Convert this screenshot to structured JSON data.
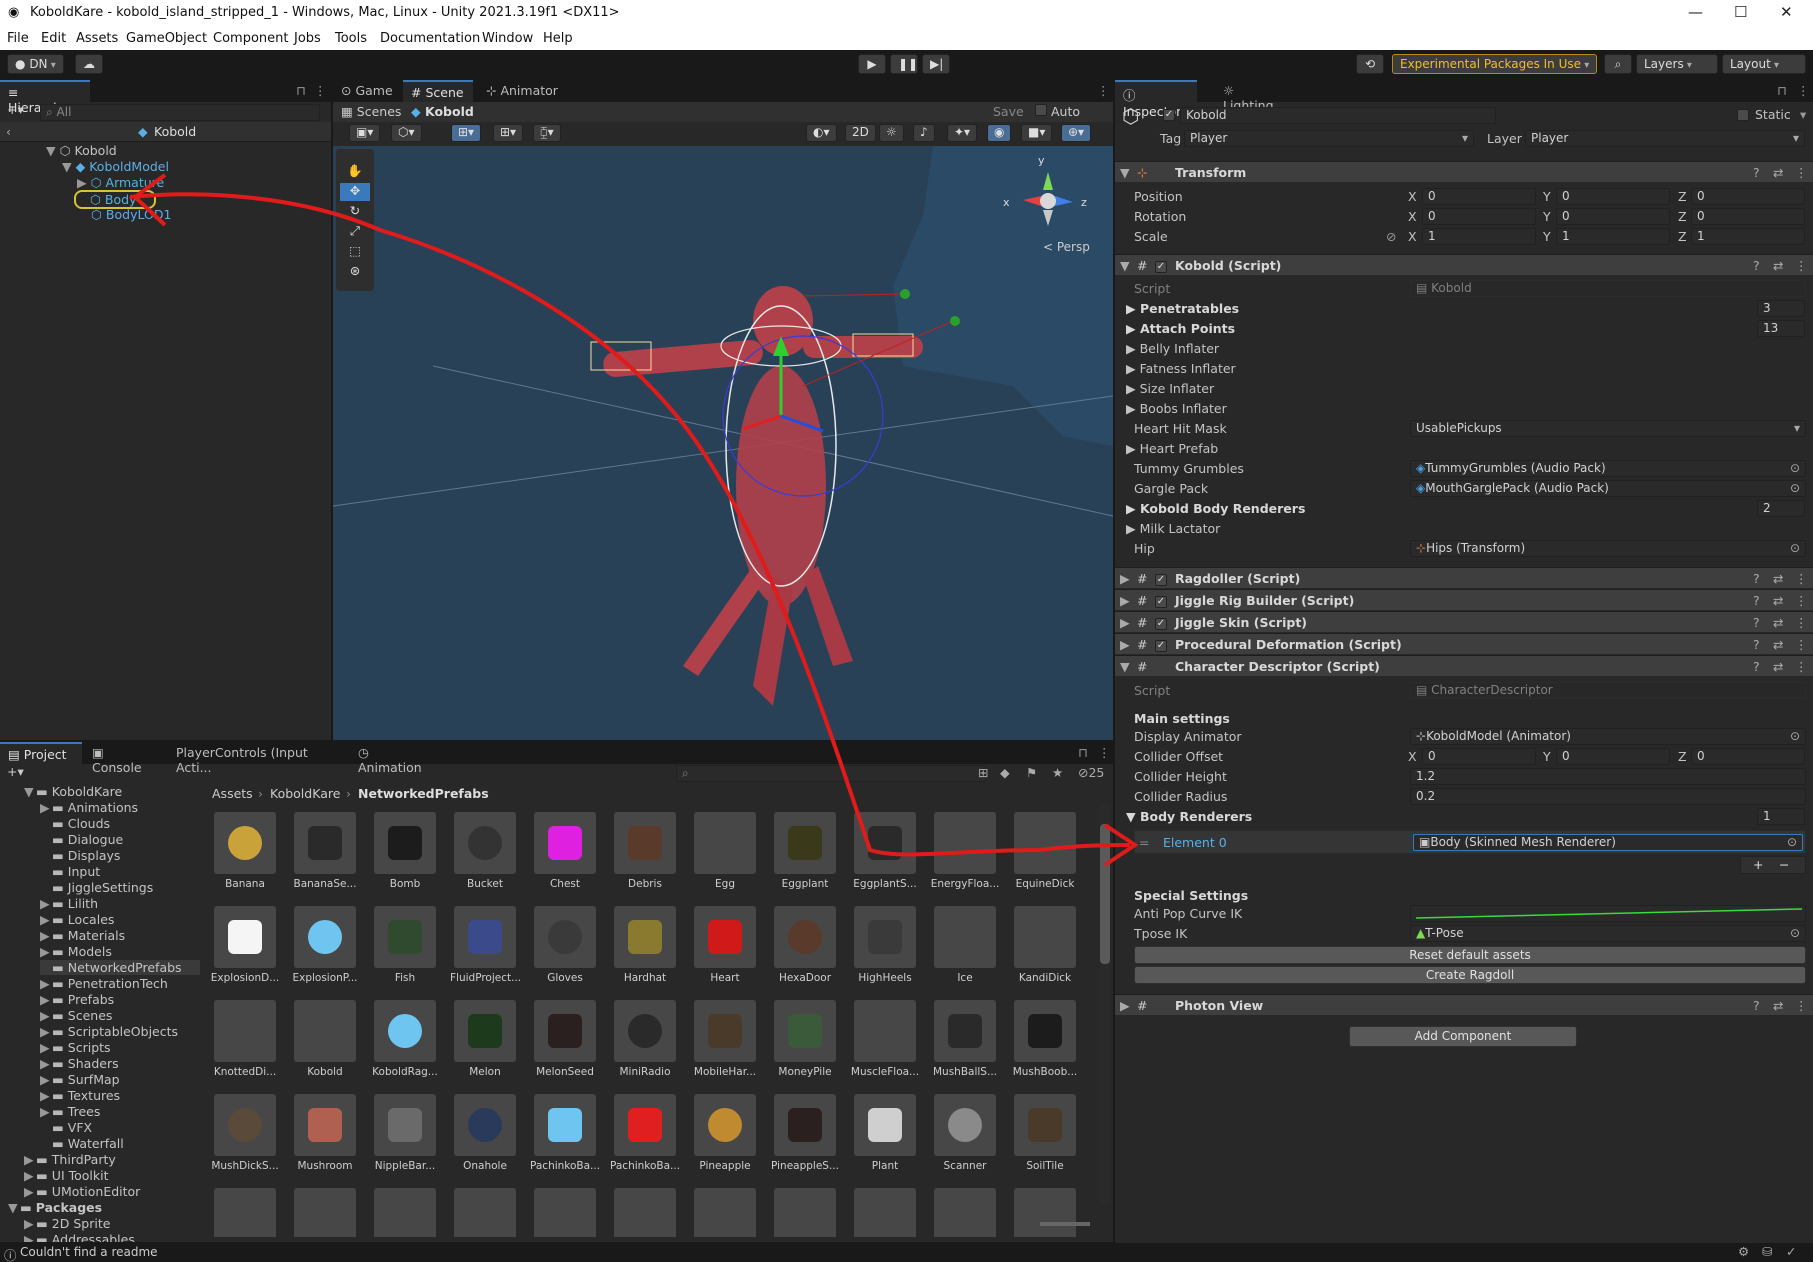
{
  "window": {
    "title": "KoboldKare - kobold_island_stripped_1 - Windows, Mac, Linux - Unity 2021.3.19f1 <DX11>",
    "minimize": "—",
    "maximize": "☐",
    "close": "✕"
  },
  "menu": [
    "File",
    "Edit",
    "Assets",
    "GameObject",
    "Component",
    "Jobs",
    "Tools",
    "Documentation",
    "Window",
    "Help"
  ],
  "toolbar": {
    "account": "DN",
    "experimental": "Experimental Packages In Use",
    "layers": "Layers",
    "layout": "Layout"
  },
  "hierarchy": {
    "tab": "Hierarchy",
    "search_placeholder": "All",
    "scene": "Kobold",
    "items": [
      "Kobold",
      "KoboldModel",
      "Armature",
      "Body",
      "BodyLOD1"
    ]
  },
  "scene_view": {
    "tabs": [
      "Game",
      "Scene",
      "Animator"
    ],
    "breadcrumb_root": "Scenes",
    "breadcrumb_prefab": "Kobold",
    "save": "Save",
    "auto_save": "Auto Save",
    "mode_2d": "2D",
    "persp": "< Persp",
    "gizmo_axes": {
      "x": "x",
      "y": "y",
      "z": "z"
    }
  },
  "inspector": {
    "tabs": [
      "Inspector",
      "Lighting"
    ],
    "object_name": "Kobold",
    "static": "Static",
    "tag_label": "Tag",
    "tag_value": "Player",
    "layer_label": "Layer",
    "layer_value": "Player",
    "transform": {
      "title": "Transform",
      "position": {
        "label": "Position",
        "x": "0",
        "y": "0",
        "z": "0"
      },
      "rotation": {
        "label": "Rotation",
        "x": "0",
        "y": "0",
        "z": "0"
      },
      "scale": {
        "label": "Scale",
        "x": "1",
        "y": "1",
        "z": "1"
      }
    },
    "kobold_script": {
      "title": "Kobold (Script)",
      "script_label": "Script",
      "script_value": "Kobold",
      "penetratables": {
        "label": "Penetratables",
        "value": "3"
      },
      "attach_points": {
        "label": "Attach Points",
        "value": "13"
      },
      "belly": "Belly Inflater",
      "fatness": "Fatness Inflater",
      "size": "Size Inflater",
      "boobs": "Boobs Inflater",
      "heart_hit_mask": {
        "label": "Heart Hit Mask",
        "value": "UsablePickups"
      },
      "heart_prefab": "Heart Prefab",
      "tummy": {
        "label": "Tummy Grumbles",
        "value": "TummyGrumbles (Audio Pack)"
      },
      "gargle": {
        "label": "Gargle Pack",
        "value": "MouthGarglePack (Audio Pack)"
      },
      "body_renderers": {
        "label": "Kobold Body Renderers",
        "value": "2"
      },
      "milk": "Milk Lactator",
      "hip": {
        "label": "Hip",
        "value": "Hips (Transform)"
      }
    },
    "components": [
      "Ragdoller (Script)",
      "Jiggle Rig Builder (Script)",
      "Jiggle Skin (Script)",
      "Procedural Deformation (Script)"
    ],
    "character_descriptor": {
      "title": "Character Descriptor (Script)",
      "script_label": "Script",
      "script_value": "CharacterDescriptor",
      "main_settings": "Main settings",
      "display_animator": {
        "label": "Display Animator",
        "value": "KoboldModel (Animator)"
      },
      "collider_offset": {
        "label": "Collider Offset",
        "x": "0",
        "y": "0",
        "z": "0"
      },
      "collider_height": {
        "label": "Collider Height",
        "value": "1.2"
      },
      "collider_radius": {
        "label": "Collider Radius",
        "value": "0.2"
      },
      "body_renderers": {
        "label": "Body Renderers",
        "value": "1"
      },
      "element0": {
        "label": "Element 0",
        "value": "Body (Skinned Mesh Renderer)"
      },
      "special_settings": "Special Settings",
      "anti_pop": "Anti Pop Curve IK",
      "tpose": {
        "label": "Tpose IK",
        "value": "T-Pose"
      },
      "reset_button": "Reset default assets",
      "create_ragdoll": "Create Ragdoll"
    },
    "photon_view": "Photon View",
    "add_component": "Add Component"
  },
  "project": {
    "tabs": [
      "Project",
      "Console",
      "PlayerControls (Input Acti...",
      "Animation"
    ],
    "hidden_count": "25",
    "breadcrumb": [
      "Assets",
      "KoboldKare",
      "NetworkedPrefabs"
    ],
    "folders": [
      "KoboldKare",
      "Animations",
      "Clouds",
      "Dialogue",
      "Displays",
      "Input",
      "JiggleSettings",
      "Lilith",
      "Locales",
      "Materials",
      "Models",
      "NetworkedPrefabs",
      "PenetrationTech",
      "Prefabs",
      "Scenes",
      "ScriptableObjects",
      "Scripts",
      "Shaders",
      "SurfMap",
      "Textures",
      "Trees",
      "VFX",
      "Waterfall",
      "ThirdParty",
      "UI Toolkit",
      "UMotionEditor",
      "Packages",
      "2D Sprite",
      "Addressables"
    ],
    "assets": [
      "Banana",
      "BananaSe...",
      "Bomb",
      "Bucket",
      "Chest",
      "Debris",
      "Egg",
      "Eggplant",
      "EggplantS...",
      "EnergyFloa...",
      "EquineDick",
      "ExplosionD...",
      "ExplosionP...",
      "Fish",
      "FluidProject...",
      "Gloves",
      "Hardhat",
      "Heart",
      "HexaDoor",
      "HighHeels",
      "Ice",
      "KandiDick",
      "KnottedDi...",
      "Kobold",
      "KoboldRag...",
      "Melon",
      "MelonSeed",
      "MiniRadio",
      "MobileHar...",
      "MoneyPile",
      "MuscleFloa...",
      "MushBallS...",
      "MushBoob...",
      "MushDickS...",
      "Mushroom",
      "NippleBar...",
      "Onahole",
      "PachinkoBa...",
      "PachinkoBa...",
      "Pineapple",
      "PineappleS...",
      "Plant",
      "Scanner",
      "SoilTile"
    ]
  },
  "status": "Couldn't find a readme",
  "colors": {
    "accent": "#3a79bb",
    "annotation": "#e01b1b",
    "bg": "#191919",
    "panel": "#282828"
  }
}
